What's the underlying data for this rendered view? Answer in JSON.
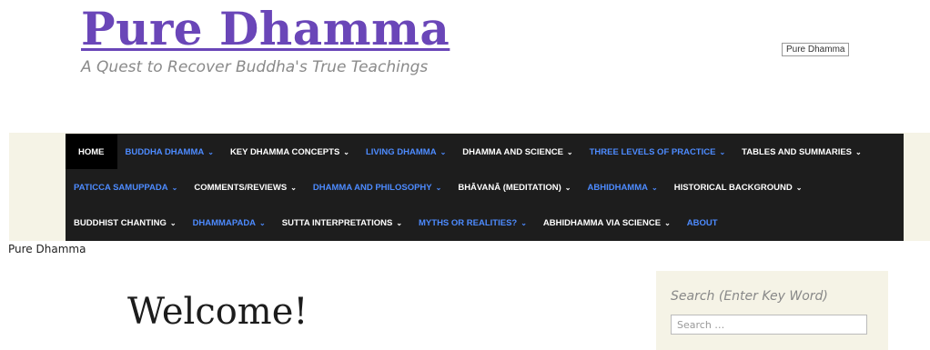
{
  "header": {
    "site_title": "Pure Dhamma",
    "tagline": "A Quest to Recover Buddha's True Teachings",
    "badge": "Pure Dhamma"
  },
  "nav": {
    "chevron": "⌄",
    "rows": [
      [
        {
          "label": "HOME",
          "has_dropdown": false,
          "style": "home"
        },
        {
          "label": "BUDDHA DHAMMA",
          "has_dropdown": true,
          "style": "blue"
        },
        {
          "label": "KEY DHAMMA CONCEPTS",
          "has_dropdown": true,
          "style": "white"
        },
        {
          "label": "LIVING DHAMMA",
          "has_dropdown": true,
          "style": "blue"
        },
        {
          "label": "DHAMMA AND SCIENCE",
          "has_dropdown": true,
          "style": "white"
        },
        {
          "label": "THREE LEVELS OF PRACTICE",
          "has_dropdown": true,
          "style": "blue"
        },
        {
          "label": "TABLES AND SUMMARIES",
          "has_dropdown": true,
          "style": "white"
        }
      ],
      [
        {
          "label": "PATICCA SAMUPPADA",
          "has_dropdown": true,
          "style": "blue"
        },
        {
          "label": "COMMENTS/REVIEWS",
          "has_dropdown": true,
          "style": "white"
        },
        {
          "label": "DHAMMA AND PHILOSOPHY",
          "has_dropdown": true,
          "style": "blue"
        },
        {
          "label": "BHĀVANĀ (MEDITATION)",
          "has_dropdown": true,
          "style": "white"
        },
        {
          "label": "ABHIDHAMMA",
          "has_dropdown": true,
          "style": "blue"
        },
        {
          "label": "HISTORICAL BACKGROUND",
          "has_dropdown": true,
          "style": "white"
        }
      ],
      [
        {
          "label": "BUDDHIST CHANTING",
          "has_dropdown": true,
          "style": "white"
        },
        {
          "label": "DHAMMAPADA",
          "has_dropdown": true,
          "style": "blue"
        },
        {
          "label": "SUTTA INTERPRETATIONS",
          "has_dropdown": true,
          "style": "white"
        },
        {
          "label": "MYTHS OR REALITIES?",
          "has_dropdown": true,
          "style": "blue"
        },
        {
          "label": "ABHIDHAMMA VIA SCIENCE",
          "has_dropdown": true,
          "style": "white"
        },
        {
          "label": "ABOUT",
          "has_dropdown": false,
          "style": "blue"
        }
      ]
    ]
  },
  "breadcrumb": "Pure Dhamma",
  "main": {
    "heading": "Welcome!"
  },
  "sidebar": {
    "title": "Search (Enter Key Word)",
    "search_placeholder": "Search …",
    "search_value": ""
  },
  "colors": {
    "title": "#6a46b8",
    "nav_bg": "#1d1d1d",
    "nav_blue": "#4d8bff",
    "band": "#f5f3e6"
  }
}
